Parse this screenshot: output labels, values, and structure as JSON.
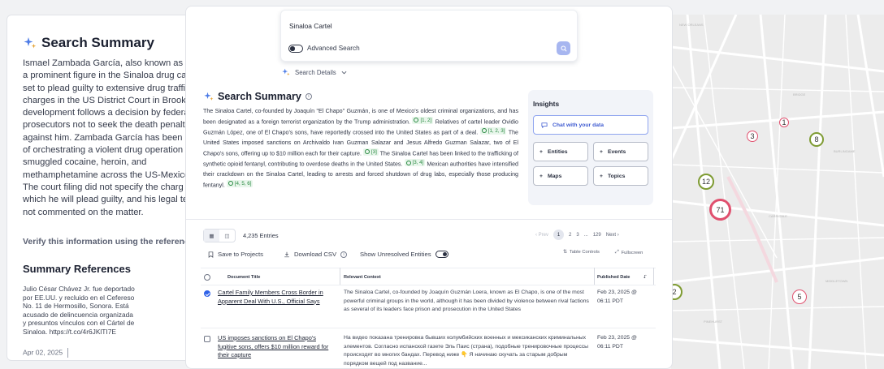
{
  "map": {
    "clusters": [
      {
        "label": "3",
        "color": "#e0506e"
      },
      {
        "label": "1",
        "color": "#e0506e"
      },
      {
        "label": "8",
        "color": "#7e9b32"
      },
      {
        "label": "12",
        "color": "#7e9b32"
      },
      {
        "label": "71",
        "color": "#e0506e"
      },
      {
        "label": "2",
        "color": "#7e9b32"
      },
      {
        "label": "5",
        "color": "#e0506e"
      }
    ]
  },
  "left_card": {
    "title": "Search Summary",
    "body_lines": [
      "Ismael Zambada García, also known as E",
      "a prominent figure in the Sinaloa drug ca",
      "set to plead guilty to extensive drug traffi",
      "charges in the US District Court in Brook",
      "development follows a decision by federa",
      "prosecutors not to seek the death penalt",
      "against him. Zambada García has been a",
      "of orchestrating a violent drug operation",
      "smuggled cocaine, heroin, and",
      "methamphetamine across the US-Mexico",
      "The court filing did not specify the charg",
      "which he will plead guilty, and his legal te",
      "not commented on the matter."
    ],
    "verify": "Verify this information using the references",
    "references_title": "Summary References",
    "reference_lines": [
      "Julio César Chávez Jr. fue deportado",
      "por EE.UU. y recluido en el Cefereso",
      "No. 11 de Hermosillo, Sonora. Está",
      "acusado de delincuencia organizada",
      "y presuntos vínculos con el Cártel de",
      "Sinaloa. https://t.co/4r6JKlTI7E"
    ],
    "reference_date": "Apr 02, 2025"
  },
  "search": {
    "query": "Sinaloa Cartel",
    "advanced_label": "Advanced Search",
    "details_label": "Search Details"
  },
  "summary": {
    "title": "Search Summary",
    "paragraph": [
      {
        "t": "The Sinaloa Cartel, co-founded by Joaquín \"El Chapo\" Guzmán, is one of Mexico's oldest criminal organizations, and has been designated as a foreign terrorist organization by the Trump administration."
      },
      {
        "c": "[1, 2]"
      },
      {
        "t": " Relatives of cartel leader Ovidio Guzmán López, one of El Chapo's sons, have reportedly crossed into the United States as part of a deal."
      },
      {
        "c": "[1, 2, 3]"
      },
      {
        "t": " The United States imposed sanctions on Archivaldo Ivan Guzman Salazar and Jesus Alfredo Guzman Salazar, two of El Chapo's sons, offering up to $10 million each for their capture."
      },
      {
        "c": "[3]"
      },
      {
        "t": " The Sinaloa Cartel has been linked to the trafficking of synthetic opioid fentanyl, contributing to overdose deaths in the United States."
      },
      {
        "c": "[3, 4]"
      },
      {
        "t": " Mexican authorities have intensified their crackdown on the Sinaloa Cartel, leading to arrests and forced shutdown of drug labs, especially those producing fentanyl."
      },
      {
        "c": "[4, 5, 6]"
      }
    ]
  },
  "insights": {
    "title": "Insights",
    "chat": "Chat with your data",
    "entities": "Entities",
    "events": "Events",
    "maps": "Maps",
    "topics": "Topics"
  },
  "table": {
    "entries": "4,235 Entries",
    "pager": {
      "prev": "Prev",
      "p1": "1",
      "p2": "2",
      "p3": "3",
      "ellipsis": "...",
      "last": "129",
      "next": "Next"
    },
    "save": "Save to Projects",
    "download": "Download CSV",
    "unresolved": "Show Unresolved Entities",
    "controls": "Table Controls",
    "fullscreen": "Fullscreen",
    "headers": {
      "title": "Document Title",
      "context": "Relevant Context",
      "date": "Published Date"
    },
    "rows": [
      {
        "title": "Cartel Family Members Cross Border in Apparent Deal With U.S., Official Says",
        "context": "The Sinaloa Cartel, co-founded by Joaquín Guzmán Loera, known as El Chapo, is one of the most powerful criminal groups in the world, although it has been divided by violence between rival factions as several of its leaders face prison and prosecution in the United States",
        "date": "Feb 23, 2025 @ 06:11 PDT",
        "checked": true
      },
      {
        "title": "US imposes sanctions on El Chapo's fugitive sons, offers $10 million reward for their capture",
        "context": "На видео показана тренировка бывших колумбийских военных и мексиканских криминальных элементов. Согласно испанской газете Эль Паис (страна), подобные тренировочные процессы происходят во многих бандах. Перевод ниже 👇 Я начинаю скучать за старым добрым порядком вещей под название...",
        "date": "Feb 23, 2025 @ 06:11 PDT",
        "checked": false
      }
    ]
  }
}
